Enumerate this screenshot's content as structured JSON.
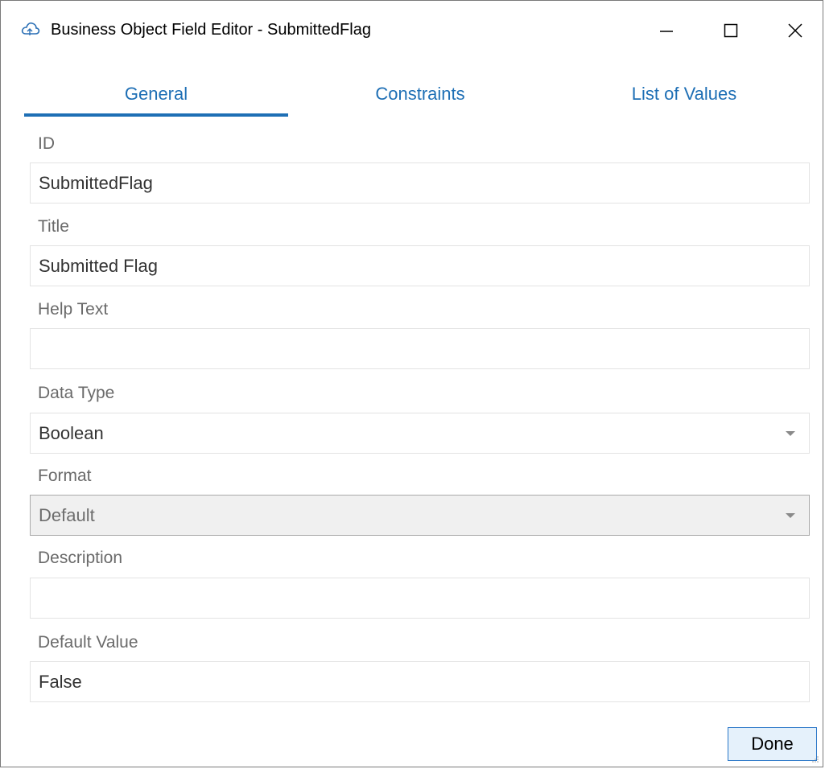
{
  "window": {
    "title": "Business Object Field Editor - SubmittedFlag",
    "app_icon": "cloud-icon",
    "controls": [
      "minimize-icon",
      "maximize-icon",
      "close-icon"
    ]
  },
  "tabs": [
    {
      "label": "General",
      "active": true
    },
    {
      "label": "Constraints",
      "active": false
    },
    {
      "label": "List of Values",
      "active": false
    }
  ],
  "form": {
    "id": {
      "label": "ID",
      "value": "SubmittedFlag"
    },
    "title": {
      "label": "Title",
      "value": "Submitted Flag"
    },
    "help_text": {
      "label": "Help Text",
      "value": ""
    },
    "data_type": {
      "label": "Data Type",
      "value": "Boolean"
    },
    "format": {
      "label": "Format",
      "value": "Default",
      "disabled": true
    },
    "description": {
      "label": "Description",
      "value": ""
    },
    "default_value": {
      "label": "Default Value",
      "value": "False"
    }
  },
  "buttons": {
    "done_label": "Done"
  },
  "colors": {
    "accent": "#1e6fb5",
    "label": "#6a6a6a",
    "field_border": "#e3e3e3",
    "disabled_bg": "#f0f0f0",
    "done_bg": "#e5f1fb",
    "done_border": "#2a77c8"
  }
}
